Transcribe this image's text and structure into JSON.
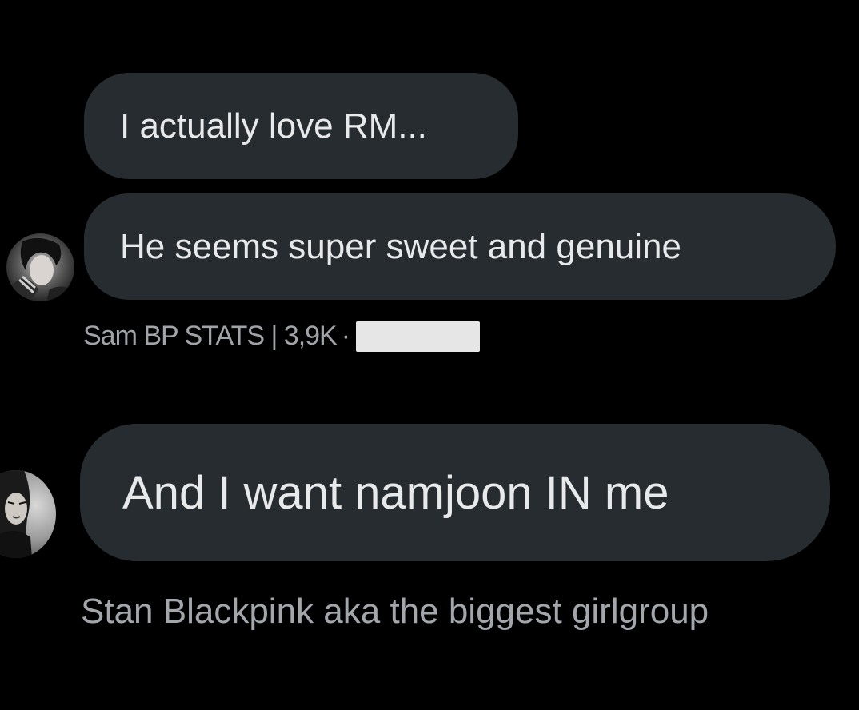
{
  "messages": [
    {
      "text": "I actually love RM..."
    },
    {
      "text": "He seems super sweet and genuine"
    },
    {
      "text": "And I want namjoon IN me"
    }
  ],
  "senders": [
    {
      "name": "Sam BP STATS | 3,9K",
      "separator": "·"
    },
    {
      "name": "Stan Blackpink aka the biggest girlgroup"
    }
  ],
  "colors": {
    "background": "#000000",
    "bubble": "#272c31",
    "text": "#e7e9ea",
    "meta_text": "#a0a4a8",
    "redaction": "#e6e6e6"
  }
}
